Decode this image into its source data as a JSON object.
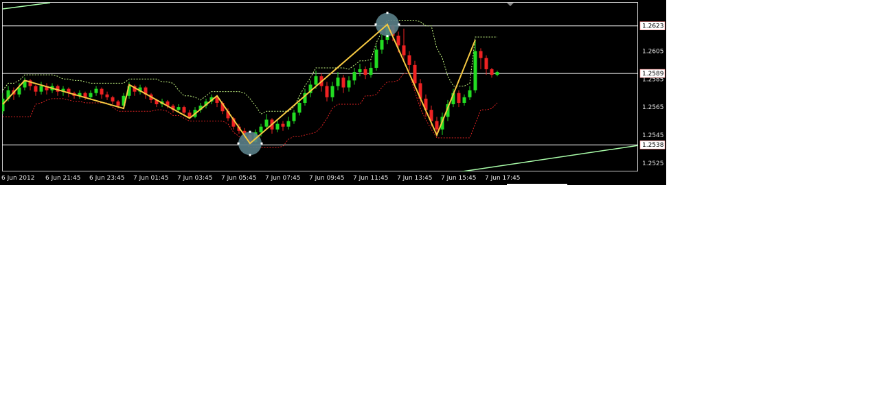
{
  "chart_data": {
    "type": "candlestick",
    "colors": {
      "background": "#000000",
      "bull_candle": "#22dd22",
      "bear_candle": "#ee2222",
      "zigzag": "#f5c842",
      "upper_band": "#ccff88",
      "lower_band": "#dd2222",
      "trendline": "#aaffaa",
      "horizontal_level": "#ffffff",
      "pivot_marker": "#5a8088"
    },
    "yaxis": {
      "ticks": [
        "1.2605",
        "1.2585",
        "1.2565",
        "1.2545",
        "1.2525"
      ],
      "tick_values": [
        1.2605,
        1.2585,
        1.2565,
        1.2545,
        1.2525
      ],
      "range": [
        1.2519,
        1.264
      ]
    },
    "xaxis": {
      "labels": [
        "6 Jun 2012",
        "6 Jun 21:45",
        "6 Jun 23:45",
        "7 Jun 01:45",
        "7 Jun 03:45",
        "7 Jun 05:45",
        "7 Jun 07:45",
        "7 Jun 09:45",
        "7 Jun 11:45",
        "7 Jun 13:45",
        "7 Jun 15:45",
        "7 Jun 17:45"
      ],
      "bars_per_label": 8
    },
    "price_tags": [
      {
        "label": "1.2623",
        "value": 1.2623
      },
      {
        "label": "1.2589",
        "value": 1.2589
      },
      {
        "label": "1.2538",
        "value": 1.2538
      }
    ],
    "horizontal_levels": [
      1.2623,
      1.2589,
      1.2538
    ],
    "zigzag": [
      {
        "bar": 0,
        "price": 1.2567
      },
      {
        "bar": 4,
        "price": 1.2584
      },
      {
        "bar": 22,
        "price": 1.2564
      },
      {
        "bar": 23,
        "price": 1.2581
      },
      {
        "bar": 34,
        "price": 1.2557
      },
      {
        "bar": 39,
        "price": 1.2573
      },
      {
        "bar": 45,
        "price": 1.2539
      },
      {
        "bar": 70,
        "price": 1.2624
      },
      {
        "bar": 79,
        "price": 1.2545
      },
      {
        "bar": 86,
        "price": 1.2613
      }
    ],
    "pivot_markers": [
      {
        "bar": 45,
        "price": 1.2539
      },
      {
        "bar": 70,
        "price": 1.2624
      }
    ],
    "candles": [
      [
        1.2562,
        1.2571,
        1.2575,
        1.256
      ],
      [
        1.2571,
        1.2577,
        1.258,
        1.2569
      ],
      [
        1.2577,
        1.2574,
        1.2579,
        1.257
      ],
      [
        1.2574,
        1.2579,
        1.2582,
        1.2572
      ],
      [
        1.2579,
        1.2584,
        1.2586,
        1.2577
      ],
      [
        1.2584,
        1.258,
        1.2585,
        1.2577
      ],
      [
        1.258,
        1.2576,
        1.2581,
        1.2573
      ],
      [
        1.2576,
        1.258,
        1.2583,
        1.2574
      ],
      [
        1.258,
        1.2577,
        1.2582,
        1.2574
      ],
      [
        1.2577,
        1.258,
        1.2582,
        1.2575
      ],
      [
        1.258,
        1.2576,
        1.2581,
        1.2573
      ],
      [
        1.2576,
        1.2578,
        1.258,
        1.2573
      ],
      [
        1.2578,
        1.2575,
        1.2579,
        1.2572
      ],
      [
        1.2575,
        1.2573,
        1.2576,
        1.2571
      ],
      [
        1.2573,
        1.2575,
        1.2577,
        1.2571
      ],
      [
        1.2575,
        1.2572,
        1.2576,
        1.257
      ],
      [
        1.2572,
        1.2575,
        1.2577,
        1.257
      ],
      [
        1.2575,
        1.2578,
        1.258,
        1.2573
      ],
      [
        1.2578,
        1.2574,
        1.2579,
        1.2571
      ],
      [
        1.2574,
        1.2572,
        1.2576,
        1.257
      ],
      [
        1.2572,
        1.2569,
        1.2573,
        1.2567
      ],
      [
        1.2569,
        1.2566,
        1.257,
        1.2564
      ],
      [
        1.2566,
        1.2573,
        1.2575,
        1.2564
      ],
      [
        1.2573,
        1.258,
        1.2583,
        1.2571
      ],
      [
        1.258,
        1.2576,
        1.2581,
        1.2573
      ],
      [
        1.2576,
        1.2579,
        1.2581,
        1.2574
      ],
      [
        1.2579,
        1.2574,
        1.258,
        1.2571
      ],
      [
        1.2574,
        1.257,
        1.2575,
        1.2568
      ],
      [
        1.257,
        1.2567,
        1.2571,
        1.2565
      ],
      [
        1.2567,
        1.2569,
        1.2571,
        1.2565
      ],
      [
        1.2569,
        1.2566,
        1.257,
        1.2564
      ],
      [
        1.2566,
        1.2563,
        1.2567,
        1.2561
      ],
      [
        1.2563,
        1.2565,
        1.2567,
        1.2561
      ],
      [
        1.2565,
        1.2561,
        1.2566,
        1.2559
      ],
      [
        1.2561,
        1.2558,
        1.2563,
        1.2557
      ],
      [
        1.2558,
        1.2563,
        1.2565,
        1.2557
      ],
      [
        1.2563,
        1.2566,
        1.2568,
        1.2561
      ],
      [
        1.2566,
        1.2569,
        1.2571,
        1.2564
      ],
      [
        1.2569,
        1.2572,
        1.2574,
        1.2567
      ],
      [
        1.2572,
        1.2568,
        1.2573,
        1.2565
      ],
      [
        1.2568,
        1.2562,
        1.2569,
        1.256
      ],
      [
        1.2562,
        1.2557,
        1.2564,
        1.2555
      ],
      [
        1.2557,
        1.2551,
        1.2558,
        1.2549
      ],
      [
        1.2551,
        1.2548,
        1.2553,
        1.2546
      ],
      [
        1.2548,
        1.2545,
        1.255,
        1.2542
      ],
      [
        1.2545,
        1.254,
        1.2546,
        1.2538
      ],
      [
        1.254,
        1.2547,
        1.2549,
        1.2539
      ],
      [
        1.2547,
        1.2551,
        1.2553,
        1.2544
      ],
      [
        1.2551,
        1.2556,
        1.256,
        1.2549
      ],
      [
        1.2556,
        1.2549,
        1.2557,
        1.2546
      ],
      [
        1.2549,
        1.2553,
        1.2556,
        1.2547
      ],
      [
        1.2553,
        1.2551,
        1.2555,
        1.2548
      ],
      [
        1.2551,
        1.2555,
        1.2558,
        1.2549
      ],
      [
        1.2555,
        1.2561,
        1.2563,
        1.2553
      ],
      [
        1.2561,
        1.2568,
        1.2571,
        1.2559
      ],
      [
        1.2568,
        1.2575,
        1.2578,
        1.2566
      ],
      [
        1.2575,
        1.2581,
        1.2584,
        1.2572
      ],
      [
        1.2581,
        1.2587,
        1.2591,
        1.2578
      ],
      [
        1.2587,
        1.258,
        1.2589,
        1.2576
      ],
      [
        1.258,
        1.2572,
        1.2583,
        1.2569
      ],
      [
        1.2572,
        1.258,
        1.2583,
        1.2569
      ],
      [
        1.258,
        1.2586,
        1.259,
        1.2577
      ],
      [
        1.2586,
        1.2579,
        1.2588,
        1.2575
      ],
      [
        1.2579,
        1.2584,
        1.2587,
        1.2576
      ],
      [
        1.2584,
        1.259,
        1.2593,
        1.2581
      ],
      [
        1.259,
        1.2592,
        1.2596,
        1.2587
      ],
      [
        1.2592,
        1.2588,
        1.2594,
        1.2585
      ],
      [
        1.2588,
        1.2593,
        1.2597,
        1.2586
      ],
      [
        1.2593,
        1.2606,
        1.2609,
        1.2591
      ],
      [
        1.2606,
        1.2613,
        1.2617,
        1.2603
      ],
      [
        1.2613,
        1.2623,
        1.2625,
        1.261
      ],
      [
        1.2623,
        1.2616,
        1.2624,
        1.2612
      ],
      [
        1.2616,
        1.2609,
        1.2619,
        1.2604
      ],
      [
        1.2609,
        1.2602,
        1.2621,
        1.2598
      ],
      [
        1.2602,
        1.2595,
        1.2605,
        1.2591
      ],
      [
        1.2595,
        1.2582,
        1.2598,
        1.2578
      ],
      [
        1.2582,
        1.2571,
        1.2585,
        1.2566
      ],
      [
        1.2571,
        1.2563,
        1.2574,
        1.2558
      ],
      [
        1.2563,
        1.2555,
        1.2566,
        1.2551
      ],
      [
        1.2555,
        1.2549,
        1.2558,
        1.2545
      ],
      [
        1.2549,
        1.2558,
        1.2561,
        1.2545
      ],
      [
        1.2558,
        1.2567,
        1.257,
        1.2555
      ],
      [
        1.2567,
        1.2575,
        1.2578,
        1.2565
      ],
      [
        1.2575,
        1.2568,
        1.2577,
        1.2565
      ],
      [
        1.2568,
        1.2572,
        1.2574,
        1.2566
      ],
      [
        1.2572,
        1.2577,
        1.258,
        1.257
      ],
      [
        1.2577,
        1.2605,
        1.2613,
        1.2575
      ],
      [
        1.2605,
        1.26,
        1.2607,
        1.2592
      ],
      [
        1.26,
        1.2592,
        1.2602,
        1.2588
      ],
      [
        1.2592,
        1.2588,
        1.2593,
        1.2586
      ],
      [
        1.2588,
        1.259,
        1.2591,
        1.2587
      ]
    ]
  }
}
